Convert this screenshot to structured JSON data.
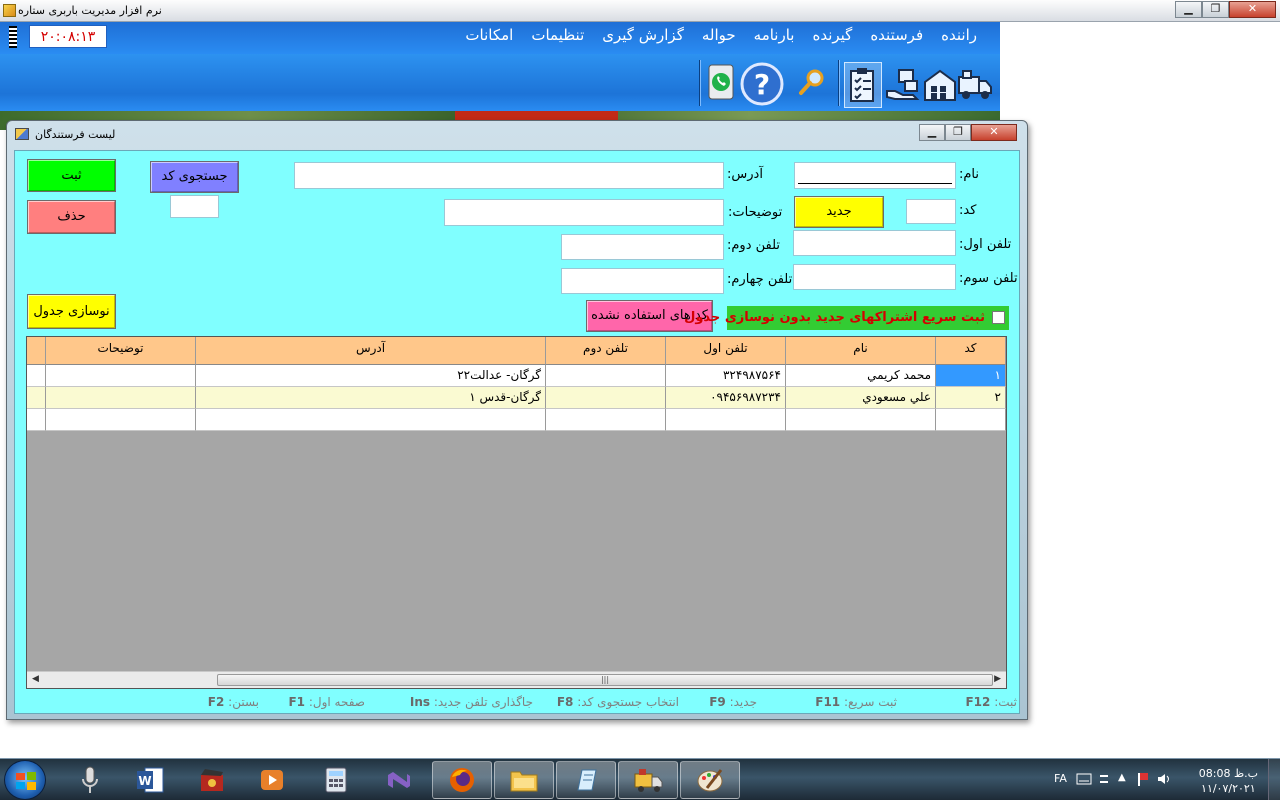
{
  "app": {
    "title": "نرم افزار مدیریت باربری ستاره",
    "clock": "۲۰:۰۸:۱۳",
    "window_buttons": {
      "minimize": "▁",
      "restore": "❐",
      "close": "✕"
    }
  },
  "menu": {
    "items": [
      "راننده",
      "فرستنده",
      "گیرنده",
      "بارنامه",
      "حواله",
      "گزارش گیری",
      "تنظیمات",
      "امکانات"
    ]
  },
  "toolbar": {
    "icons": [
      "truck-icon",
      "warehouse-icon",
      "hand-boxes-icon",
      "clipboard-checklist-icon",
      "search-icon",
      "help-icon",
      "phone-icon"
    ],
    "help_glyph": "?"
  },
  "dialog": {
    "title": "لیست فرستندگان",
    "labels": {
      "name": "نام:",
      "code": "کد:",
      "address": "آدرس:",
      "description": "توضیحات:",
      "phone1": "تلفن اول:",
      "phone2": "تلفن دوم:",
      "phone3": "تلفن سوم:",
      "phone4": "تلفن چهارم:"
    },
    "values": {
      "name": "",
      "code": "",
      "address": "",
      "description": "",
      "phone1": "",
      "phone2": "",
      "phone3": "",
      "phone4": "",
      "search_code": ""
    },
    "buttons": {
      "save": "ثبت",
      "delete": "حذف",
      "search_code": "جستجوی کد",
      "new": "جدید",
      "refresh_table": "نوسازی جدول",
      "unused_codes": "کد های استفاده نشده"
    },
    "checkbox": {
      "label": "ثبت سریع اشتراکهای جدید بدون نوسازی جدول",
      "checked": false
    },
    "grid": {
      "columns": [
        "کد",
        "نام",
        "تلفن اول",
        "تلفن دوم",
        "آدرس",
        "توضیحات"
      ],
      "rows": [
        {
          "code": "۱",
          "name": "محمد كريمي",
          "phone1": "۳۲۴۹۸۷۵۶۴",
          "phone2": "",
          "address": "گرگان- عدالت۲۲",
          "desc": ""
        },
        {
          "code": "۲",
          "name": "علي مسعودي",
          "phone1": "۰۹۴۵۶۹۸۷۲۳۴",
          "phone2": "",
          "address": "گرگان-قدس ۱",
          "desc": ""
        },
        {
          "code": "",
          "name": "",
          "phone1": "",
          "phone2": "",
          "address": "",
          "desc": ""
        }
      ],
      "scroll_grip": "|||"
    },
    "shortcuts": [
      {
        "label": "ثبت:",
        "key": "F12"
      },
      {
        "label": "ثبت سریع:",
        "key": "F11"
      },
      {
        "label": "جدید:",
        "key": "F9"
      },
      {
        "label": "انتخاب جستجوی کد:",
        "key": "F8"
      },
      {
        "label": "جاگذاری تلفن جدید:",
        "key": "Ins"
      },
      {
        "label": "صفحه اول:",
        "key": "F1"
      },
      {
        "label": "بستن:",
        "key": "F2"
      }
    ]
  },
  "taskbar": {
    "apps": [
      "microphone-icon",
      "word-icon",
      "video-editor-icon",
      "media-player-icon",
      "calculator-icon",
      "visual-studio-icon",
      "firefox-icon",
      "file-explorer-icon",
      "notepad-icon",
      "cargo-app-icon",
      "paint-icon"
    ],
    "lang": "FA",
    "time": "08:08 ب.ظ",
    "date": "۱۱/۰۷/۲۰۲۱"
  }
}
